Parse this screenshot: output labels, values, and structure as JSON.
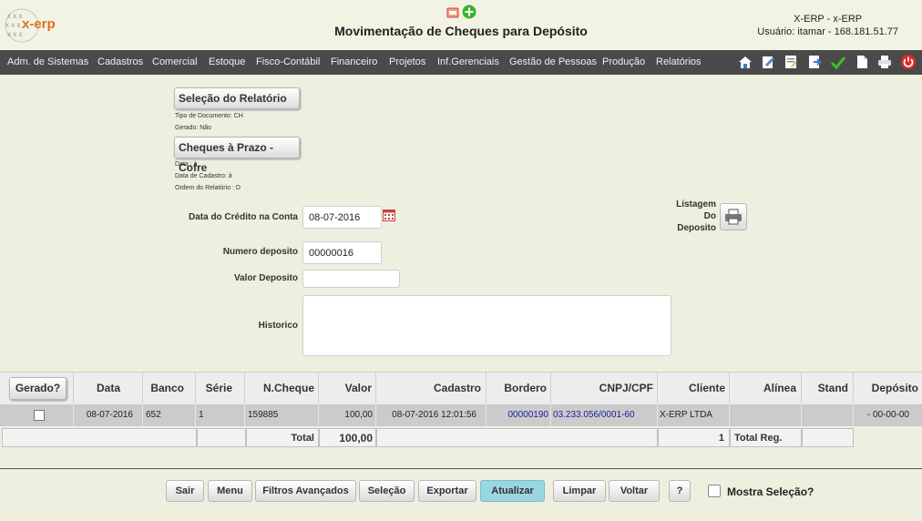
{
  "header": {
    "logo_text": "x-erp",
    "title": "Movimentação de Cheques para Depósito",
    "user_line1": "X-ERP - x-ERP",
    "user_line2": "Usuário: itamar - 168.181.51.77"
  },
  "menu": {
    "items": [
      "Adm. de Sistemas",
      "Cadastros",
      "Comercial",
      "Estoque",
      "Fisco-Contábil",
      "Financeiro",
      "Projetos",
      "Inf.Gerenciais",
      "Gestão de Pessoas",
      "Produção",
      "Relatórios"
    ]
  },
  "report": {
    "selection_button": "Seleção do Relatório",
    "tipo_documento": "Tipo de Documento: CH",
    "gerado": "Gerado: Não",
    "cheques_button": "Cheques à Prazo - Cofre",
    "data": "Data :  à",
    "data_cadastro": "Data de Cadastro:  à",
    "ordem": "Ordem do Relatório : D"
  },
  "form": {
    "data_credito_label": "Data do Crédito na Conta",
    "data_credito_value": "08-07-2016",
    "numero_deposito_label": "Numero deposito",
    "numero_deposito_value": "00000016",
    "valor_deposito_label": "Valor Deposito",
    "valor_deposito_value": "",
    "historico_label": "Historico",
    "historico_value": "",
    "listagem_label_1": "Listagem",
    "listagem_label_2": "Do",
    "listagem_label_3": "Deposito"
  },
  "table": {
    "gerado_button": "Gerado?",
    "headers": {
      "data": "Data",
      "banco": "Banco",
      "serie": "Série",
      "ncheque": "N.Cheque",
      "valor": "Valor",
      "cadastro": "Cadastro",
      "bordero": "Bordero",
      "cnpj": "CNPJ/CPF",
      "cliente": "Cliente",
      "alinea": "Alínea",
      "stand": "Stand",
      "deposito": "Depósito"
    },
    "row": {
      "data": "08-07-2016",
      "banco": "652",
      "serie": "1",
      "ncheque": "159885",
      "valor": "100,00",
      "cadastro": "08-07-2016 12:01:56",
      "bordero": "00000190",
      "cnpj": "03.233.056/0001-60",
      "cliente": "X-ERP LTDA",
      "alinea": "",
      "stand": "",
      "deposito": "- 00-00-00"
    },
    "footer": {
      "total_label": "Total",
      "total_value": "100,00",
      "count": "1",
      "total_reg_label": "Total Reg."
    }
  },
  "buttons": {
    "sair": "Sair",
    "menu": "Menu",
    "filtros": "Filtros Avançados",
    "selecao": "Seleção",
    "exportar": "Exportar",
    "atualizar": "Atualizar",
    "limpar": "Limpar",
    "voltar": "Voltar",
    "help": "?",
    "mostra_selecao": "Mostra Seleção?"
  },
  "colors": {
    "background": "#efefdf",
    "menubar": "#4a4a4a",
    "link_blue": "#1a1aa8",
    "atualizar_bg": "#9ad6e0",
    "logo_orange": "#e07020"
  }
}
